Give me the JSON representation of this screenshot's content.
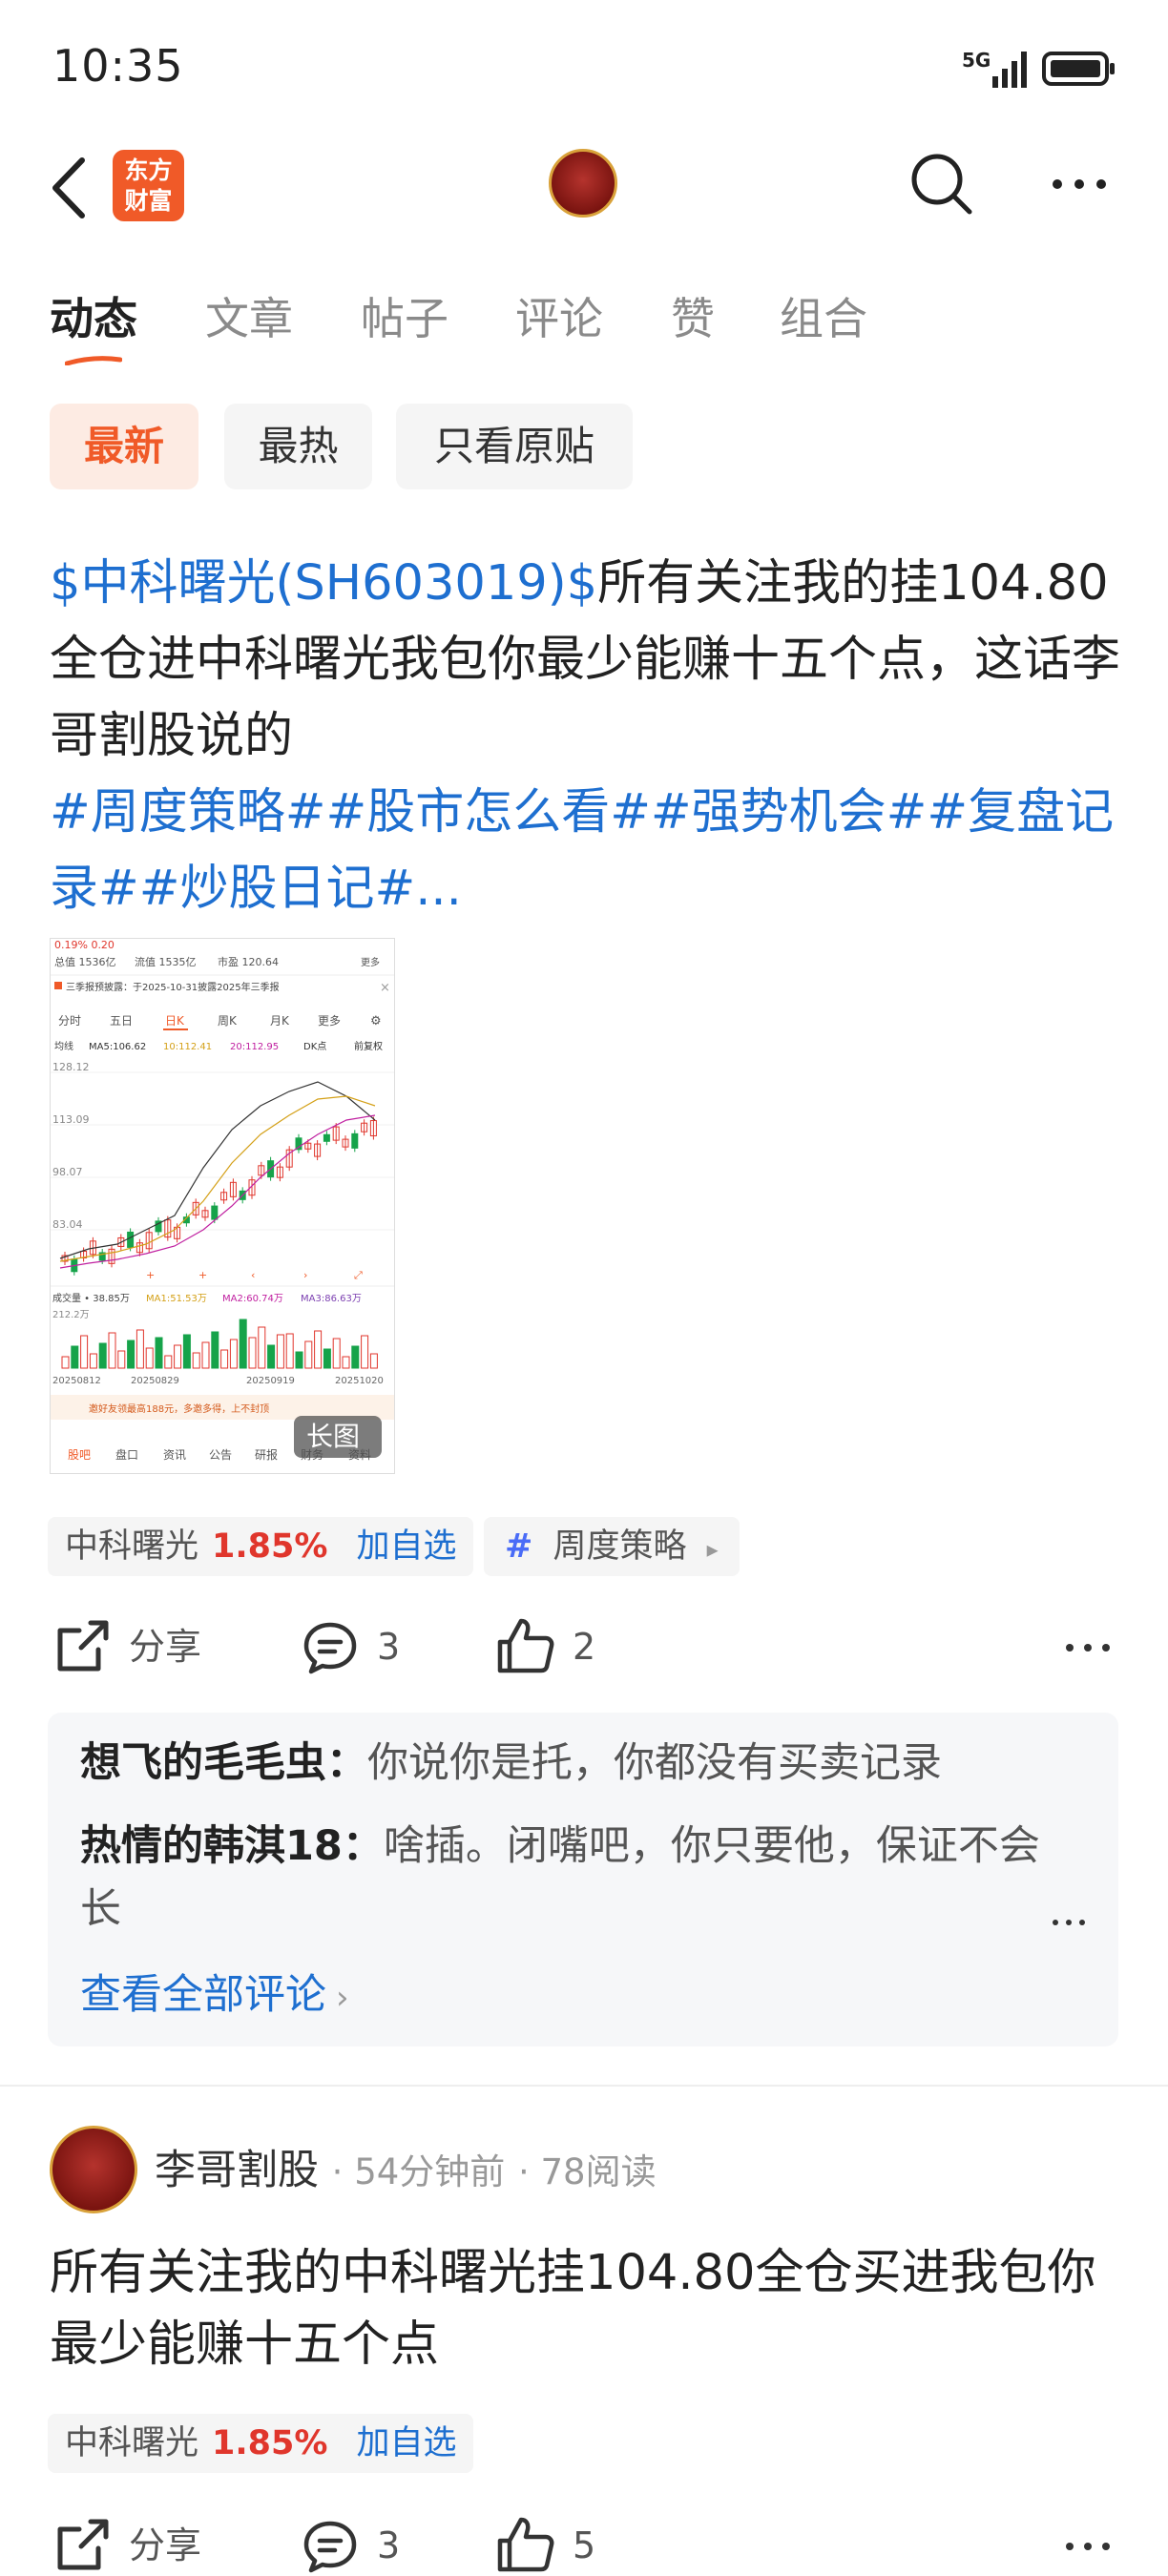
{
  "status_bar": {
    "time": "10:35",
    "network": "5G"
  },
  "header": {
    "logo_text_line1": "东方",
    "logo_text_line2": "财富"
  },
  "tabs": [
    {
      "label": "动态",
      "active": true
    },
    {
      "label": "文章"
    },
    {
      "label": "帖子"
    },
    {
      "label": "评论"
    },
    {
      "label": "赞"
    },
    {
      "label": "组合"
    }
  ],
  "filters": [
    {
      "label": "最新",
      "active": true
    },
    {
      "label": "最热"
    },
    {
      "label": "只看原贴"
    }
  ],
  "post1": {
    "stock_link": "$中科曙光(SH603019)$",
    "text": "所有关注我的挂104.80全仓进中科曙光我包你最少能赚十五个点，这话李哥割股说的",
    "hashtags": "#周度策略##股市怎么看##强势机会##复盘记录##炒股日记#...",
    "image_badge": "长图",
    "thumbnail": {
      "header_left": "0.19%  0.20",
      "row1": [
        "总值 1536亿",
        "流值 1535亿",
        "市盈 120.64",
        "更多"
      ],
      "notice": "三季报预披露：于2025-10-31披露2025年三季报",
      "periods": [
        "分时",
        "五日",
        "日K",
        "周K",
        "月K",
        "更多"
      ],
      "ma_line": [
        "均线",
        "MA5:106.62",
        "10:112.41",
        "20:112.95",
        "DK点",
        "前复权"
      ],
      "price_ticks": [
        "128.12",
        "113.09",
        "98.07",
        "83.04"
      ],
      "vol_line": [
        "成交量 • 38.85万",
        "MA1:51.53万",
        "MA2:60.74万",
        "MA3:86.63万"
      ],
      "vol_tick": "212.2万",
      "dates": [
        "20250812",
        "20250829",
        "20250919",
        "20251020"
      ],
      "promo": "邀好友领最高188元，多邀多得，上不封顶",
      "bottom_tabs": [
        "股吧",
        "盘口",
        "资讯",
        "公告",
        "研报",
        "财务",
        "资料"
      ]
    },
    "stock_tag": {
      "name": "中科曙光",
      "change": "1.85%",
      "add": "加自选"
    },
    "topic_tag": {
      "label": "周度策略"
    },
    "actions": {
      "share": "分享",
      "comments": "3",
      "likes": "2"
    },
    "comments": [
      {
        "user": "想飞的毛毛虫：",
        "text": "你说你是托，你都没有买卖记录"
      },
      {
        "user": "热情的韩淇18：",
        "text": "啥插。闭嘴吧，你只要他，保证不会长"
      }
    ],
    "view_all": "查看全部评论"
  },
  "post2": {
    "author": "李哥割股",
    "time": "54分钟前",
    "reads": "78阅读",
    "text": "所有关注我的中科曙光挂104.80全仓买进我包你最少能赚十五个点",
    "stock_tag": {
      "name": "中科曙光",
      "change": "1.85%",
      "add": "加自选"
    },
    "actions": {
      "share": "分享",
      "comments": "3",
      "likes": "5"
    }
  },
  "colors": {
    "accent": "#f05a28",
    "link": "#1e6fd0",
    "up": "#e0362c",
    "down": "#16a34a"
  }
}
